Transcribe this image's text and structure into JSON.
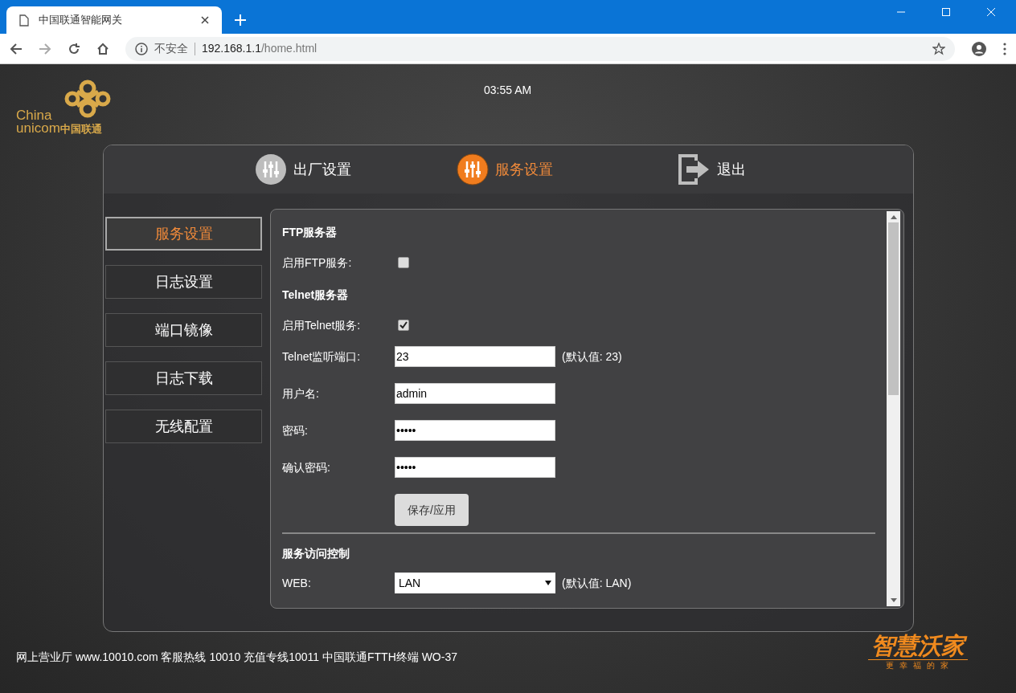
{
  "browser": {
    "tab_title": "中国联通智能网关",
    "security": "不安全",
    "host": "192.168.1.1",
    "path": "/home.html"
  },
  "header": {
    "logo_en_1": "China",
    "logo_en_2": "unicom",
    "logo_cn": "中国联通",
    "time": "03:55 AM"
  },
  "top_nav": [
    {
      "kind": "factory",
      "label": "出厂设置",
      "selected": false
    },
    {
      "kind": "service",
      "label": "服务设置",
      "selected": true
    },
    {
      "kind": "exit",
      "label": "退出",
      "selected": false
    }
  ],
  "side_menu": [
    {
      "label": "服务设置",
      "selected": true
    },
    {
      "label": "日志设置",
      "selected": false
    },
    {
      "label": "端口镜像",
      "selected": false
    },
    {
      "label": "日志下载",
      "selected": false
    },
    {
      "label": "无线配置",
      "selected": false
    }
  ],
  "content": [
    {
      "kind": "heading",
      "text": "FTP服务器"
    },
    {
      "kind": "checkbox",
      "label": "启用FTP服务:",
      "checked": false
    },
    {
      "kind": "heading",
      "text": "Telnet服务器"
    },
    {
      "kind": "checkbox",
      "label": "启用Telnet服务:",
      "checked": true
    },
    {
      "kind": "input",
      "label": "Telnet监听端口:",
      "value": "23",
      "hint": "(默认值: 23)"
    },
    {
      "kind": "input",
      "label": "用户名:",
      "value": "admin"
    },
    {
      "kind": "input",
      "label": "密码:",
      "value": "•••••"
    },
    {
      "kind": "input",
      "label": "确认密码:",
      "value": "•••••"
    },
    {
      "kind": "button",
      "label": "保存/应用"
    },
    {
      "kind": "divider"
    },
    {
      "kind": "heading",
      "text": "服务访问控制"
    },
    {
      "kind": "select",
      "label": "WEB:",
      "value": "LAN",
      "hint": "(默认值: LAN)"
    }
  ],
  "footer": {
    "text": "网上营业厅 www.10010.com 客服热线 10010 充值专线10011 中国联通FTTH终端 WO-37",
    "brand": "智慧沃家",
    "slogan": "更 幸 福 的 家"
  }
}
